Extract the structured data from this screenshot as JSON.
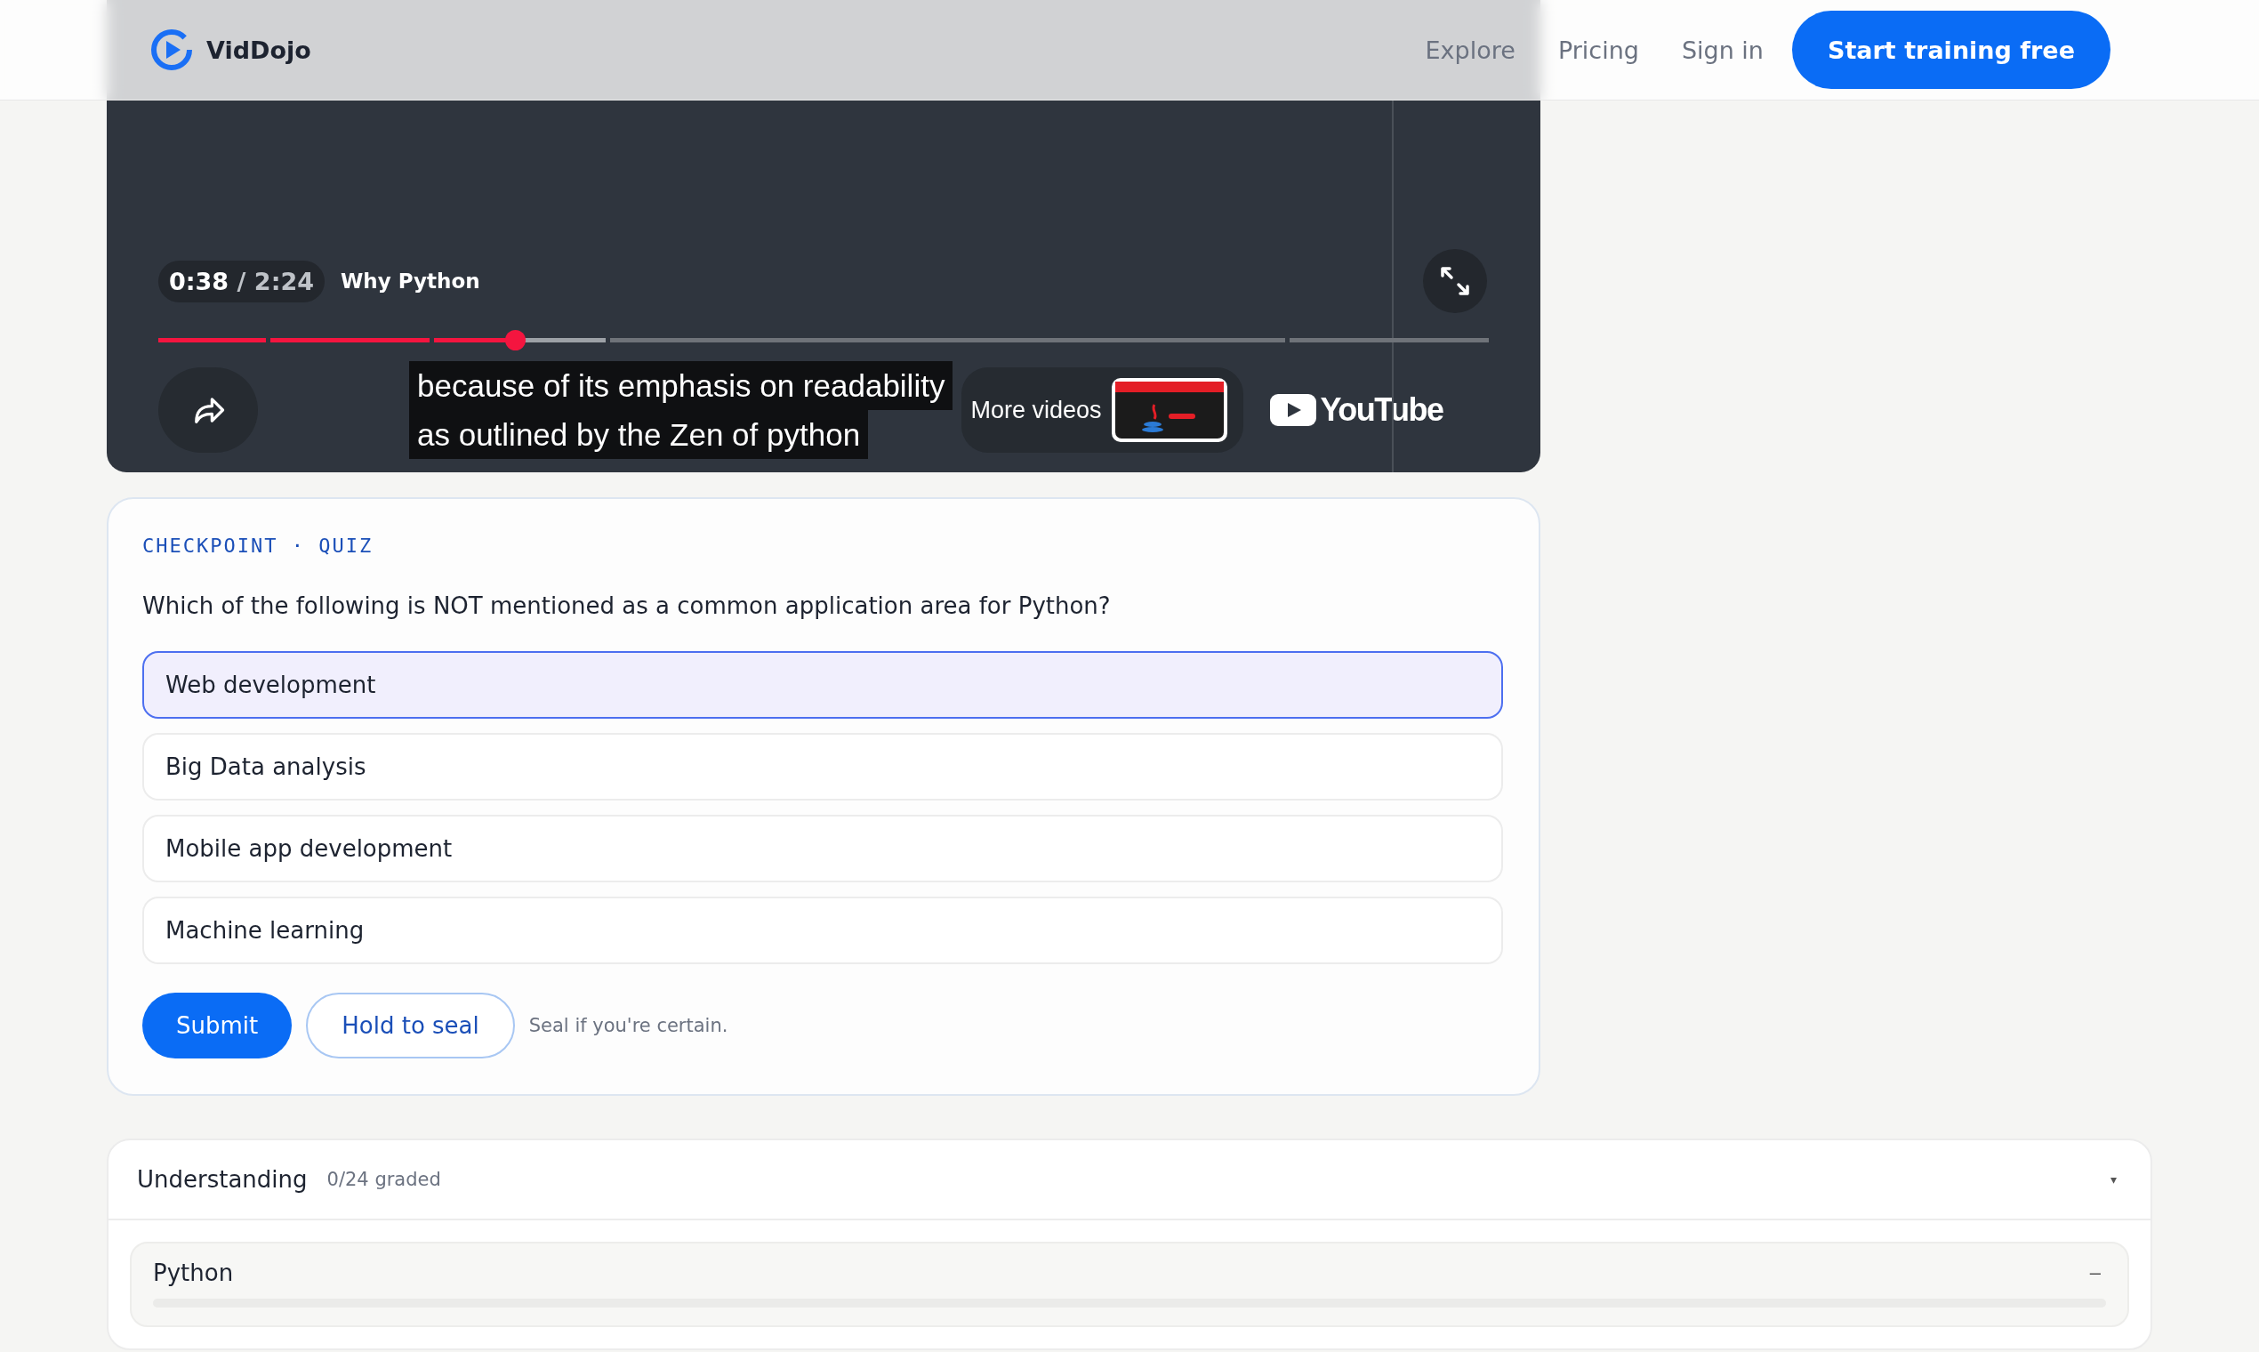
{
  "header": {
    "brand": "VidDojo",
    "nav": [
      {
        "label": "Explore"
      },
      {
        "label": "Pricing"
      },
      {
        "label": "Sign in"
      }
    ],
    "cta": "Start training free"
  },
  "video": {
    "time_current": "0:38",
    "time_total": "/ 2:24",
    "title": "Why Python",
    "progress": {
      "level": 0.268
    },
    "captions": [
      "because of its emphasis on readability",
      "as outlined by the Zen of python"
    ],
    "more_videos": "More videos",
    "thumbnail": {
      "kind": "picture"
    },
    "brand_logo": "YouTube"
  },
  "quiz": {
    "eyebrow": "CHECKPOINT · QUIZ",
    "question": "Which of the following is NOT mentioned as a common application area for Python?",
    "options": [
      {
        "label": "Web development",
        "selected": true
      },
      {
        "label": "Big Data analysis",
        "selected": false
      },
      {
        "label": "Mobile app development",
        "selected": false
      },
      {
        "label": "Machine learning",
        "selected": false
      }
    ],
    "submit": "Submit",
    "seal": "Hold to seal",
    "hint": "Seal if you're certain."
  },
  "understanding": {
    "title": "Understanding",
    "graded": "0/24 graded",
    "toggle": "▾",
    "topics": [
      {
        "name": "Python",
        "toggle": "–",
        "level": 0
      }
    ]
  }
}
